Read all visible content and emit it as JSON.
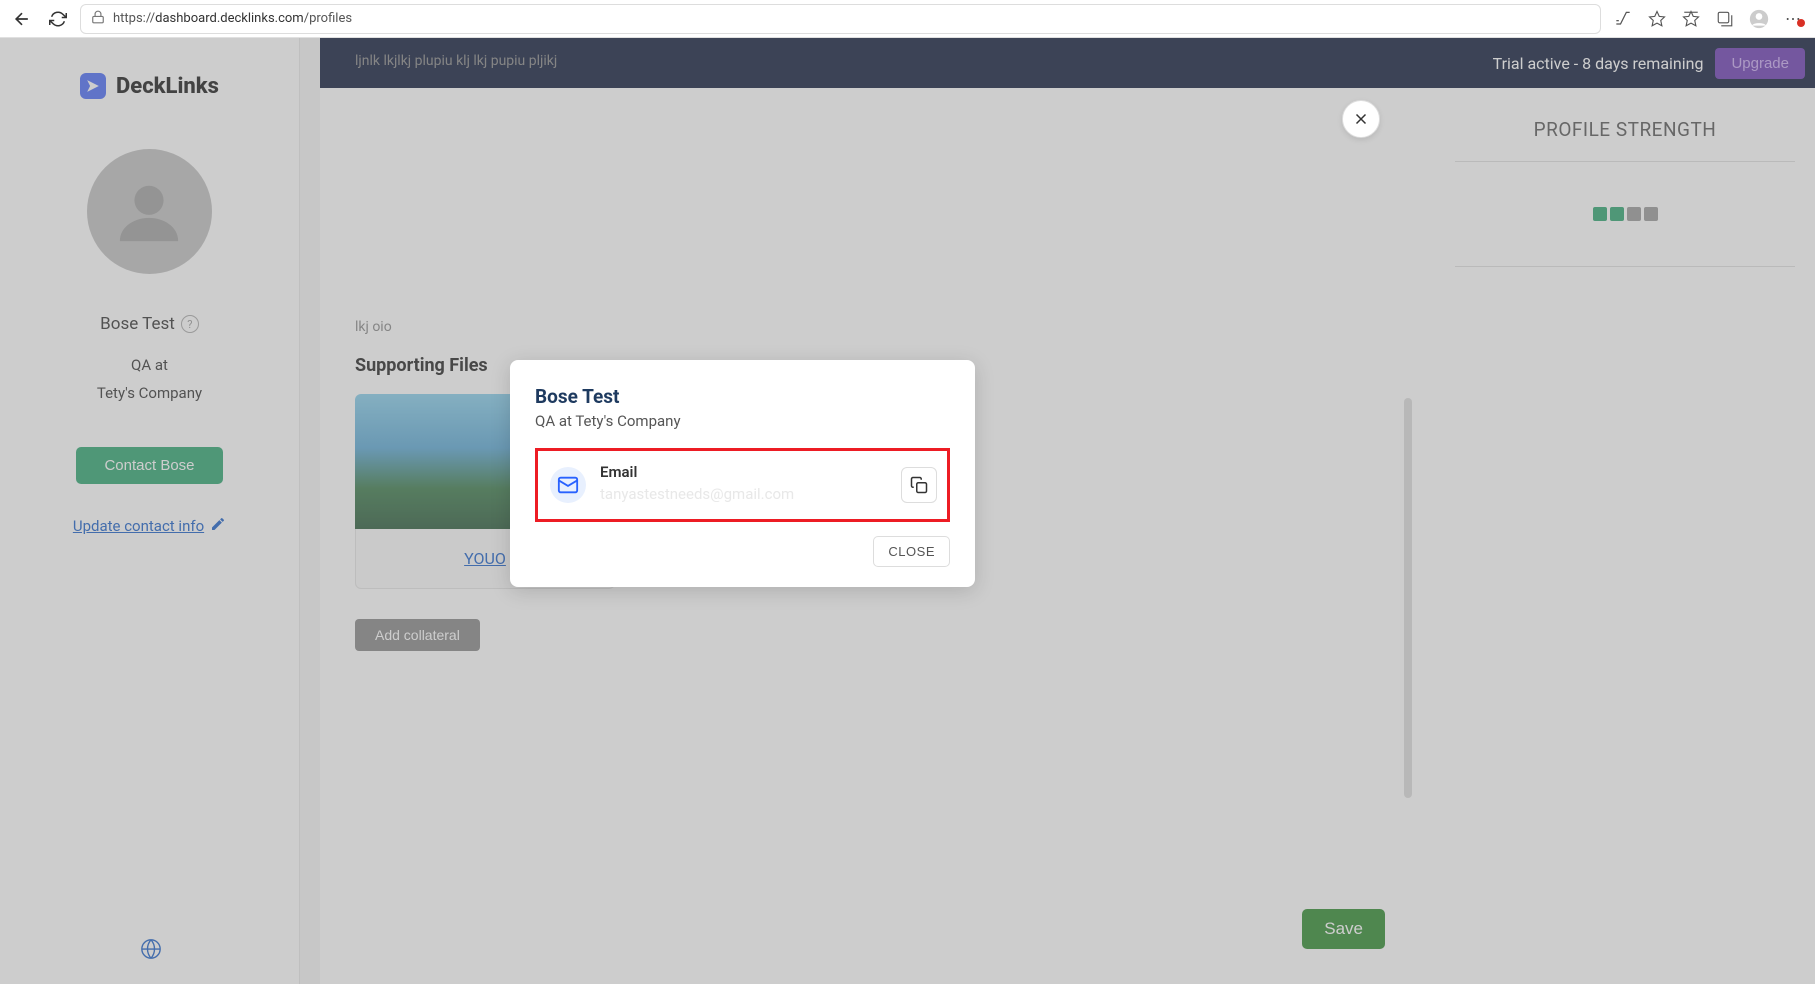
{
  "browser": {
    "url_prefix": "https://",
    "url_domain": "dashboard.decklinks.com",
    "url_path": "/profiles"
  },
  "logo": {
    "text": "DeckLinks"
  },
  "sidebar": {
    "name": "Bose Test",
    "role": "QA at",
    "company": "Tety's Company",
    "contact_btn": "Contact Bose",
    "update_link": "Update contact info"
  },
  "banner": {
    "trial_text": "Trial active - 8 days remaining",
    "upgrade": "Upgrade"
  },
  "right_panel": {
    "title": "PROFILE STRENGTH"
  },
  "center": {
    "placeholder1": "ljnlk lkjlkj plupiu klj lkj pupiu pljikj",
    "placeholder2": "lkj oio",
    "supporting_title": "Supporting Files",
    "card_label": "YOUO",
    "add_collateral": "Add collateral",
    "save": "Save"
  },
  "modal": {
    "name": "Bose Test",
    "role_company": "QA at Tety's Company",
    "email_label": "Email",
    "email_value": "tanyastestneeds@gmail.com",
    "close": "CLOSE"
  }
}
